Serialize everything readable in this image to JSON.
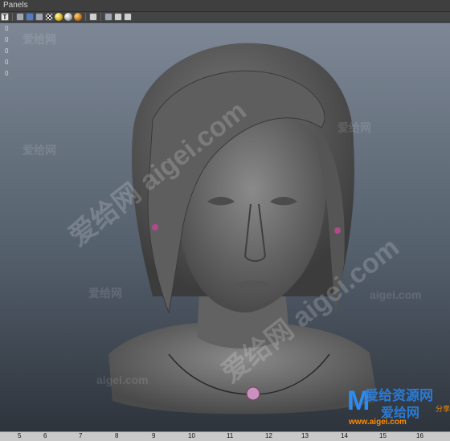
{
  "menubar": {
    "label": "Panels"
  },
  "toolbar": {
    "buttons": [
      {
        "icon": "text-t-icon",
        "label": "T"
      },
      {
        "icon": "wireframe-cube-icon"
      },
      {
        "icon": "shaded-cube-icon"
      },
      {
        "icon": "textured-cube-icon"
      },
      {
        "icon": "checker-icon"
      },
      {
        "icon": "light-sphere-yellow-icon"
      },
      {
        "icon": "light-sphere-white-icon"
      },
      {
        "icon": "light-sphere-orange-icon"
      },
      {
        "icon": "isolate-select-icon"
      },
      {
        "icon": "xray-cube-icon"
      },
      {
        "icon": "xray-joints-icon"
      },
      {
        "icon": "share-icon"
      }
    ]
  },
  "hud": {
    "lines": [
      "0",
      "0",
      "0",
      "0",
      "0"
    ]
  },
  "ruler": {
    "labels": [
      "5",
      "6",
      "7",
      "8",
      "9",
      "10",
      "11",
      "12",
      "13",
      "14",
      "15",
      "16"
    ]
  },
  "watermark": {
    "site_cn": "爱给网",
    "site_en": "aigei.com",
    "diagonal": "爱给网 aigei.com",
    "logo_m": "M",
    "logo_line1": "爱给资源网",
    "logo_line2": "爱给网",
    "logo_url": "www.aigei.com",
    "logo_tag": "分享"
  },
  "colors": {
    "viewport_top": "#7d8795",
    "viewport_bottom": "#2e343c",
    "model_gray": "#6f6f6f",
    "earring": "#b04a8c"
  }
}
